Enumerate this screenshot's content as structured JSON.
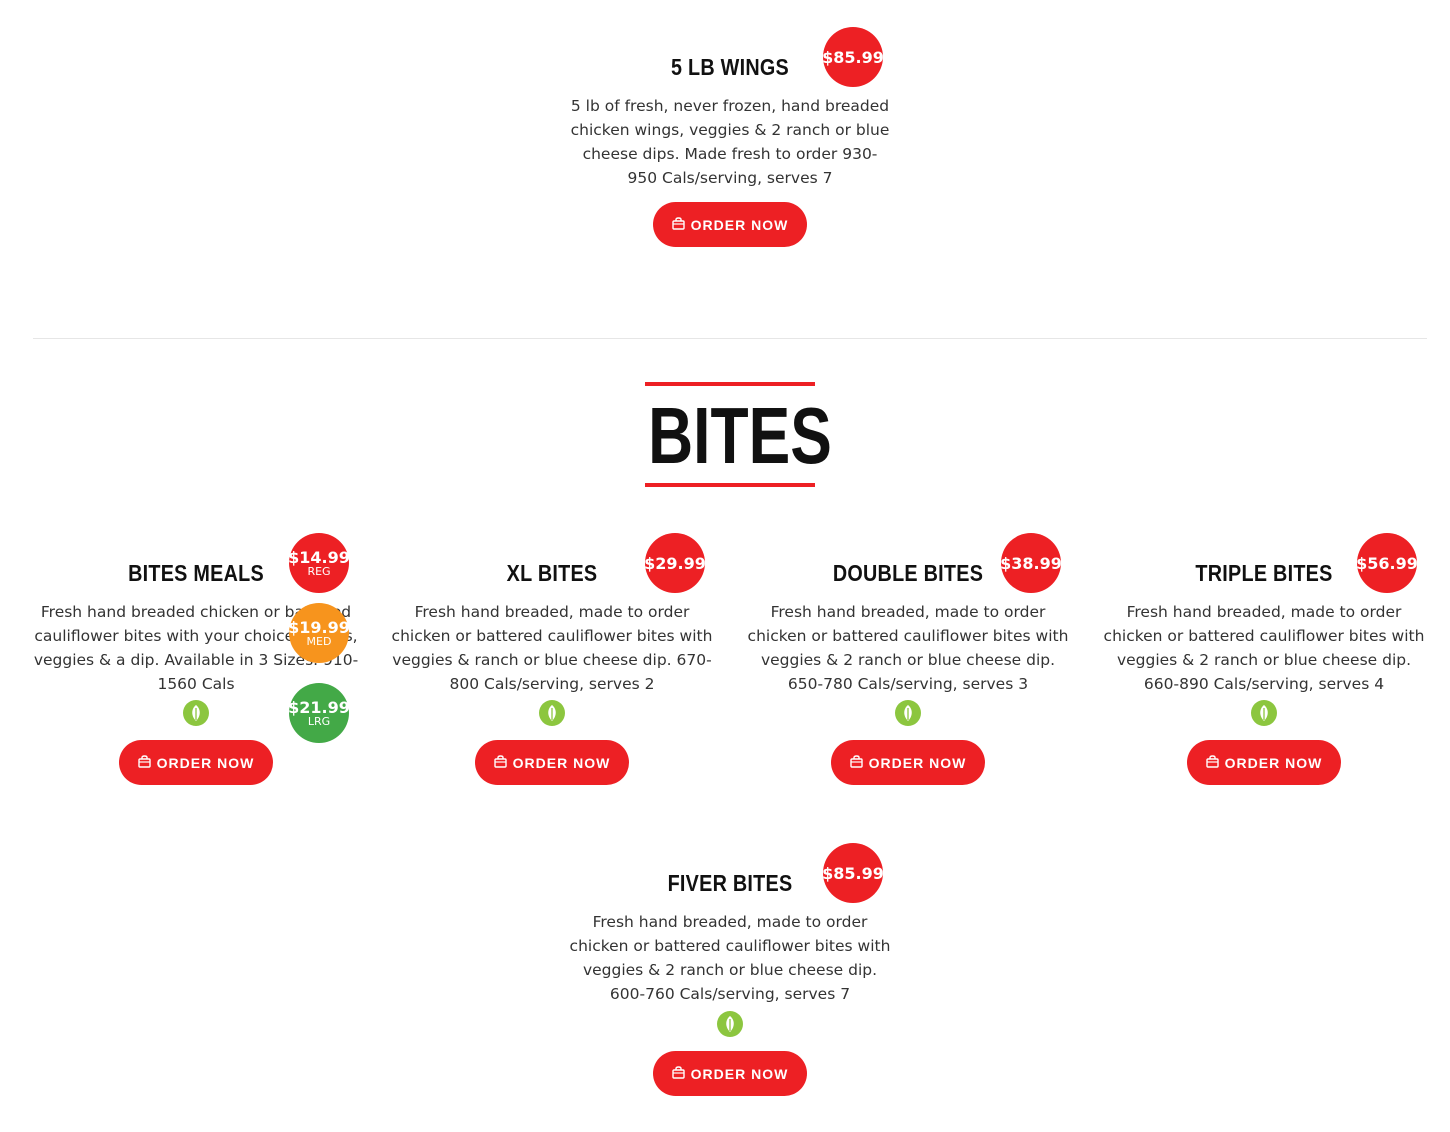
{
  "top_item": {
    "title": "5 LB WINGS",
    "price": "$85.99",
    "description": "5 lb of fresh, never frozen, hand breaded chicken wings, veggies & 2 ranch or blue cheese dips. Made fresh to order 930-950 Cals/serving, serves 7",
    "button": "ORDER NOW"
  },
  "section": {
    "title": "BITES"
  },
  "items": [
    {
      "title": "BITES MEALS",
      "description": "Fresh hand breaded chicken or battered cauliflower bites with your choice of fries, veggies & a dip. Available in 3 Sizes. 910-1560 Cals",
      "prices": [
        {
          "amount": "$14.99",
          "size": "REG",
          "color": "#ed2024"
        },
        {
          "amount": "$19.99",
          "size": "MED",
          "color": "#f7941d"
        },
        {
          "amount": "$21.99",
          "size": "LRG",
          "color": "#43a947"
        }
      ],
      "button": "ORDER NOW"
    },
    {
      "title": "XL BITES",
      "price": "$29.99",
      "description": "Fresh hand breaded, made to order chicken or battered cauliflower bites with veggies & ranch or blue cheese dip. 670-800 Cals/serving, serves 2",
      "button": "ORDER NOW"
    },
    {
      "title": "DOUBLE BITES",
      "price": "$38.99",
      "description": "Fresh hand breaded, made to order chicken or battered cauliflower bites with veggies & 2 ranch or blue cheese dip. 650-780 Cals/serving, serves 3",
      "button": "ORDER NOW"
    },
    {
      "title": "TRIPLE BITES",
      "price": "$56.99",
      "description": "Fresh hand breaded, made to order chicken or battered cauliflower bites with veggies & 2 ranch or blue cheese dip. 660-890 Cals/serving, serves 4",
      "button": "ORDER NOW"
    },
    {
      "title": "FIVER BITES",
      "price": "$85.99",
      "description": "Fresh hand breaded, made to order chicken or battered cauliflower bites with veggies & 2 ranch or blue cheese dip. 600-760 Cals/serving, serves 7",
      "button": "ORDER NOW"
    }
  ],
  "icons": {
    "order": "shopping-bag-icon",
    "veggie": "leaf-icon"
  },
  "colors": {
    "accent": "#ed2024",
    "medium": "#f7941d",
    "large": "#43a947",
    "veggie": "#8cc63f"
  }
}
